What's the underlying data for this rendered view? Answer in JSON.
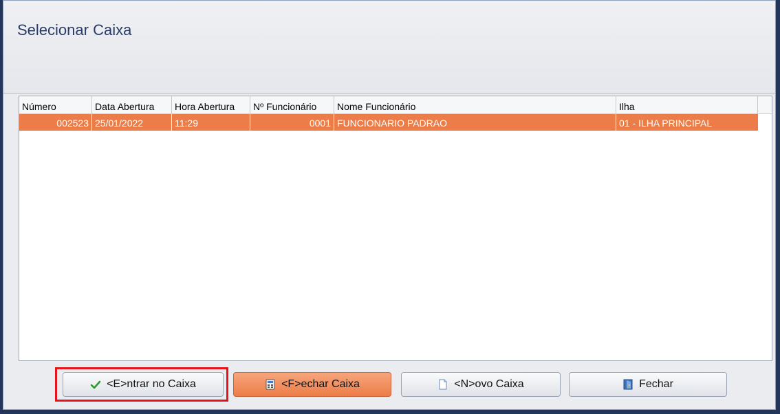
{
  "dialog": {
    "title": "Selecionar Caixa"
  },
  "grid": {
    "columns": [
      "Número",
      "Data Abertura",
      "Hora Abertura",
      "Nº Funcionário",
      "Nome Funcionário",
      "Ilha"
    ],
    "rows": [
      {
        "numero": "002523",
        "data_abertura": "25/01/2022",
        "hora_abertura": "11:29",
        "num_funcionario": "0001",
        "nome_funcionario": "FUNCIONARIO PADRAO",
        "ilha": "01 - ILHA PRINCIPAL"
      }
    ],
    "selected_row_color": "#ec7d48"
  },
  "buttons": {
    "entrar": {
      "label": "<E>ntrar no Caixa",
      "icon": "checkmark-icon"
    },
    "fechar_caixa": {
      "label": "<F>echar Caixa",
      "icon": "close-register-icon"
    },
    "novo_caixa": {
      "label": "<N>ovo Caixa",
      "icon": "new-document-icon"
    },
    "fechar": {
      "label": "Fechar",
      "icon": "exit-door-icon"
    }
  }
}
